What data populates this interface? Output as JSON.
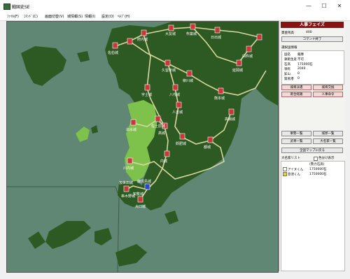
{
  "window": {
    "title": "戦国史SE",
    "minimize_glyph": "—",
    "maximize_glyph": "☐",
    "close_glyph": "✕"
  },
  "menu": [
    {
      "label": "ﾌｧｲﾙ(F)"
    },
    {
      "label": "ｺﾏﾝﾄﾞ(C)"
    },
    {
      "label": "画面切替(V)"
    },
    {
      "label": "城情報(S)"
    },
    {
      "label": "情報(I)"
    },
    {
      "label": "設定(O)"
    },
    {
      "label": "ﾍﾙﾌﾟ(H)"
    }
  ],
  "panel": {
    "phase_title": "人事フェイズ",
    "fund_label": "資金残高",
    "fund_value": "400",
    "end_command": "コマンド終了",
    "selected_castle_label": "選択国情報",
    "info": {
      "name_k": "国名",
      "name_v": "薩摩",
      "prod_k": "鉄砲生産",
      "prod_v": "不可",
      "koku_k": "石高",
      "koku_v": "175000石",
      "pop_k": "領有",
      "pop_v": "2040",
      "mine_k": "鉱山",
      "mine_v": "0",
      "trade_k": "貿易港",
      "trade_v": "0"
    },
    "buttons": {
      "dispatch": "城将派遣",
      "exchange": "城将交換",
      "hire": "寄合経路",
      "personnel": "人事命令",
      "army_list": "軍勢一覧",
      "general_list": "武将一覧",
      "castle_list": "城郭一覧",
      "daimyo_list": "大名家一覧",
      "back_to_map": "全国マップに戻る"
    },
    "clan_list_label": "大名家リスト",
    "show_all_label": "色分け表示",
    "clan_header": "(勢力石高)",
    "clans": [
      {
        "name": "アイヌくん",
        "koku": "1750000石",
        "color": "#ffffff"
      },
      {
        "name": "島津くん",
        "koku": "1750000石",
        "color": "#f0d020"
      }
    ]
  },
  "map": {
    "colors": {
      "sea": "#5f8774",
      "land_dark": "#2c5a22",
      "land_light": "#7ec24c",
      "road": "#d9d6a0",
      "castle_red": "#c83838",
      "castle_blue": "#2a48c8",
      "label": "#ffffff"
    },
    "castles": [
      {
        "name": "佐伯城"
      },
      {
        "name": "府内城"
      },
      {
        "name": "大友城"
      },
      {
        "name": "杵築城"
      },
      {
        "name": "日出城"
      },
      {
        "name": "久留米城"
      },
      {
        "name": "柳川城"
      },
      {
        "name": "熊本城"
      },
      {
        "name": "宇土城"
      },
      {
        "name": "八代城"
      },
      {
        "name": "人吉城"
      },
      {
        "name": "高鍋城"
      },
      {
        "name": "延岡城"
      },
      {
        "name": "佐土原城"
      },
      {
        "name": "飫肥城"
      },
      {
        "name": "都城"
      },
      {
        "name": "出水城"
      },
      {
        "name": "川内城"
      },
      {
        "name": "内城"
      },
      {
        "name": "鹿児島城"
      },
      {
        "name": "加世田城"
      },
      {
        "name": "知覧城"
      },
      {
        "name": "串木野城"
      },
      {
        "name": "大口城"
      },
      {
        "name": "高城"
      },
      {
        "name": "臼杵城"
      }
    ]
  }
}
